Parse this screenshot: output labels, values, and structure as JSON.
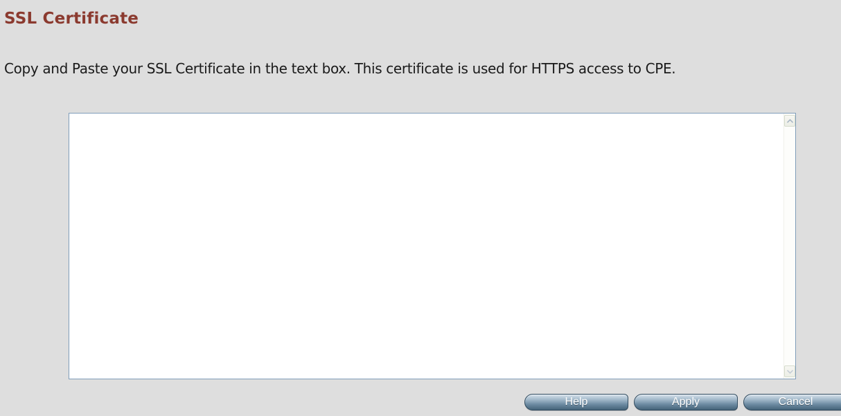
{
  "page": {
    "title": "SSL Certificate",
    "instructions": "Copy and Paste your SSL Certificate in the text box. This certificate is used for HTTPS access to CPE."
  },
  "certificate_field": {
    "value": "",
    "scrollbar": {
      "up_icon": "scroll-up-arrow",
      "down_icon": "scroll-down-arrow"
    }
  },
  "buttons": {
    "help_label": "Help",
    "apply_label": "Apply",
    "cancel_label": "Cancel"
  },
  "colors": {
    "title": "#8b3a2f",
    "background": "#dedede",
    "textbox_border": "#7f9db9",
    "button_dark": "#456479",
    "button_light": "#d7e3ec"
  }
}
